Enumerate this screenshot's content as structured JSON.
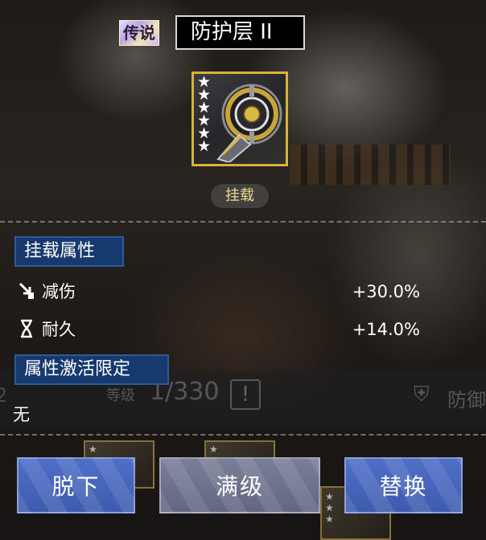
{
  "header": {
    "rarity_label": "传说",
    "equipment_name": "防护层 II"
  },
  "equipment": {
    "icon": "shield-gear-icon",
    "star_count": 6,
    "status_label": "挂载"
  },
  "mount_attributes": {
    "title": "挂载属性",
    "stats": [
      {
        "icon": "damage-reduction-icon",
        "label": "减伤",
        "value": "+30.0%"
      },
      {
        "icon": "hourglass-icon",
        "label": "耐久",
        "value": "+14.0%"
      }
    ]
  },
  "activation_restriction": {
    "title": "属性激活限定",
    "value": "无"
  },
  "background": {
    "level_label": "等级",
    "level_value": "1/330",
    "defense_label": "防御",
    "left_number": "2"
  },
  "actions": {
    "unequip_label": "脱下",
    "max_level_label": "满级",
    "replace_label": "替换"
  },
  "colors": {
    "rarity_gold": "#d7b23c",
    "section_blue": "#173a6e",
    "button_blue": "#4e6fc8",
    "button_gray": "#7a7f98",
    "status_text": "#f0d98a"
  }
}
